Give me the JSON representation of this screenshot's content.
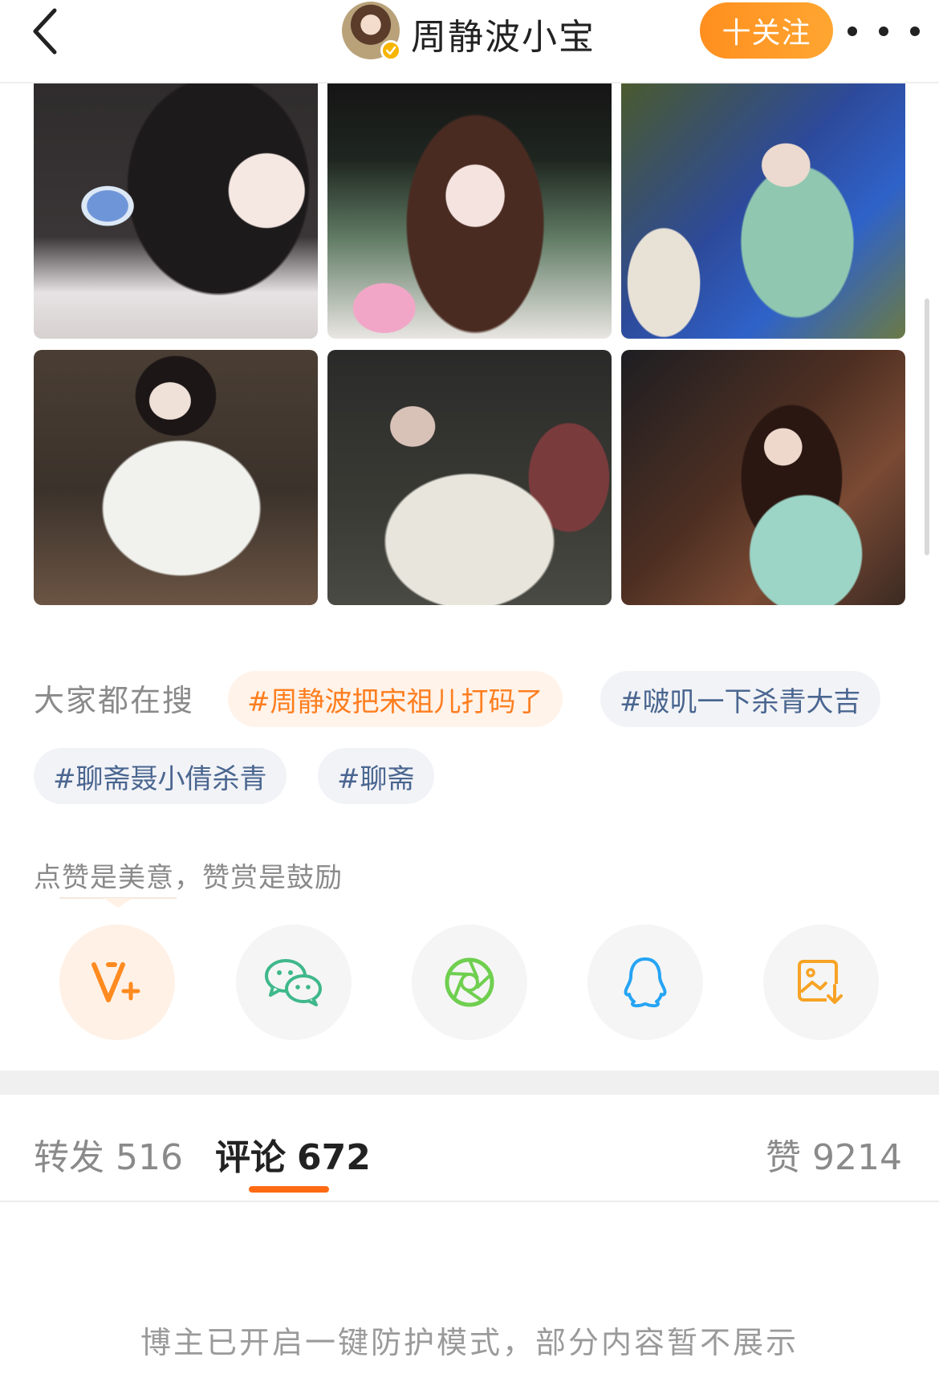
{
  "header": {
    "user_name": "周静波小宝",
    "follow_label": "十关注"
  },
  "trending": {
    "label": "大家都在搜",
    "tags": [
      "#周静波把宋祖儿打码了",
      "#啵叽一下杀青大吉",
      "#聊斋聂小倩杀青",
      "#聊斋"
    ]
  },
  "appreciation": {
    "text": "点赞是美意，赞赏是鼓励"
  },
  "tabs": {
    "repost": {
      "label": "转发",
      "count": "516"
    },
    "comment": {
      "label": "评论",
      "count": "672"
    },
    "like": {
      "label": "赞",
      "count": "9214"
    }
  },
  "notice": "博主已开启一键防护模式，部分内容暂不展示",
  "colors": {
    "accent_orange": "#ff8f1f",
    "tab_indicator": "#ff6a13",
    "tag_blue": "#4a6690",
    "wechat_green": "#3fb88b",
    "moments_green": "#6fcf4f",
    "qq_blue": "#25a4f4",
    "save_orange": "#f7a325"
  },
  "icons": {
    "back": "chevron-left-icon",
    "more": "more-dots-icon",
    "verify": "verified-badge-icon",
    "reward": "v-plus-icon",
    "wechat": "wechat-icon",
    "moments": "moments-aperture-icon",
    "qq": "qq-penguin-icon",
    "save": "save-image-icon"
  }
}
